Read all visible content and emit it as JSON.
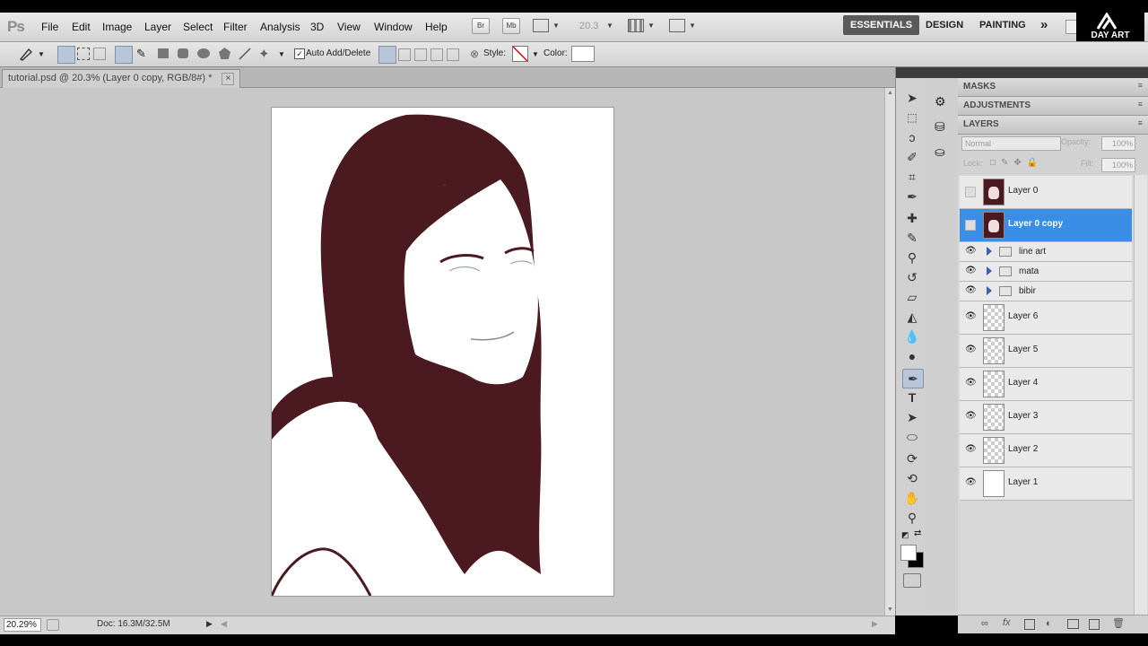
{
  "app": {
    "logo": "Ps"
  },
  "menu": {
    "items": [
      "File",
      "Edit",
      "Image",
      "Layer",
      "Select",
      "Filter",
      "Analysis",
      "3D",
      "View",
      "Window",
      "Help"
    ]
  },
  "appbar": {
    "zoom_value": "20.3",
    "workspaces": [
      "ESSENTIALS",
      "DESIGN",
      "PAINTING"
    ],
    "more": "»"
  },
  "watermark": {
    "text": "DAY ART"
  },
  "options": {
    "auto_add_delete": "Auto Add/Delete",
    "style_label": "Style:",
    "color_label": "Color:"
  },
  "document": {
    "tab_title": "tutorial.psd @ 20.3% (Layer 0 copy, RGB/8#) *",
    "close": "×"
  },
  "status": {
    "zoom": "20.29%",
    "doc_info": "Doc: 16.3M/32.5M"
  },
  "panels": {
    "masks": "MASKS",
    "adjustments": "ADJUSTMENTS",
    "layers": "LAYERS",
    "blend_mode": "Normal",
    "opacity_label": "Opacity:",
    "opacity_value": "100%",
    "lock_label": "Lock:",
    "fill_label": "Fill:",
    "fill_value": "100%"
  },
  "layers": [
    {
      "name": "Layer 0",
      "visible": false,
      "thumb": "portrait"
    },
    {
      "name": "Layer 0 copy",
      "visible": false,
      "thumb": "portrait",
      "selected": true
    },
    {
      "name": "line art",
      "visible": true,
      "group": true
    },
    {
      "name": "mata",
      "visible": true,
      "group": true
    },
    {
      "name": "bibir",
      "visible": true,
      "group": true
    },
    {
      "name": "Layer 6",
      "visible": true,
      "thumb": "transparent"
    },
    {
      "name": "Layer 5",
      "visible": true,
      "thumb": "transparent"
    },
    {
      "name": "Layer 4",
      "visible": true,
      "thumb": "transparent"
    },
    {
      "name": "Layer 3",
      "visible": true,
      "thumb": "transparent"
    },
    {
      "name": "Layer 2",
      "visible": true,
      "thumb": "transparent"
    },
    {
      "name": "Layer 1",
      "visible": true,
      "thumb": "white"
    }
  ],
  "colors": {
    "hair": "#4a1a20",
    "accent": "#3a8ee6",
    "chrome_dark": "#3c3c3c"
  }
}
